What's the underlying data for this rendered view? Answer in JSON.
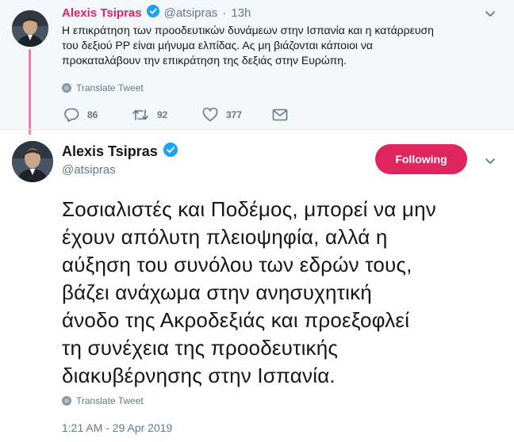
{
  "reply_tweet": {
    "author_name": "Alexis Tsipras",
    "handle": "@atsipras",
    "separator": "·",
    "time": "13h",
    "text_lines": [
      "Η επικράτηση των προοδευτικών δυνάμεων στην Ισπανία και η κατάρρευση",
      "του δεξιού PP είναι μήνυμα ελπίδας. Ας μη βιάζονται κάποιοι να",
      "προκαταλάβουν την επικράτηση της δεξιάς στην Ευρώπη."
    ],
    "translate_label": "Translate Tweet",
    "replies": "86",
    "retweets": "92",
    "likes": "377"
  },
  "main_tweet": {
    "author_name": "Alexis Tsipras",
    "handle": "@atsipras",
    "follow_label": "Following",
    "text_lines": [
      "Σοσιαλιστές και Ποδέμος, μπορεί να μην",
      "έχουν απόλυτη πλειοψηφία, αλλά η",
      "αύξηση του συνόλου των εδρών τους,",
      "βάζει ανάχωμα στην ανησυχητική",
      "άνοδο της Ακροδεξιάς και προεξοφλεί",
      "τη συνέχεια της προοδευτικής",
      "διακυβέρνησης στην Ισπανία."
    ],
    "translate_label": "Translate Tweet",
    "timestamp": "1:21 AM - 29 Apr 2019"
  },
  "colors": {
    "accent": "#e0245e",
    "verified": "#1da1f2",
    "secondary_text": "#657786",
    "top_background": "#f5f8fa"
  },
  "icons": [
    "avatar-icon",
    "verified-badge-icon",
    "chevron-down-icon",
    "globe-icon",
    "reply-icon",
    "retweet-icon",
    "like-icon",
    "direct-message-icon"
  ]
}
